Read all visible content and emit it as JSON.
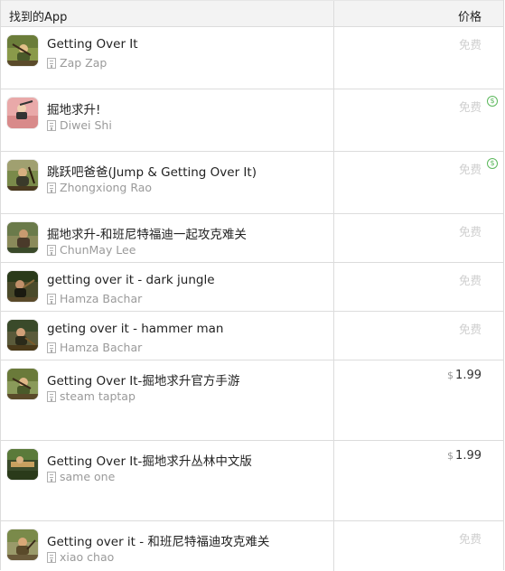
{
  "header": {
    "app_col": "找到的App",
    "price_col": "价格"
  },
  "rows": [
    {
      "name": "Getting Over It",
      "developer": "Zap Zap",
      "price": "免费",
      "paid": false,
      "iap": false
    },
    {
      "name": "掘地求升!",
      "developer": "Diwei Shi",
      "price": "免费",
      "paid": false,
      "iap": true
    },
    {
      "name": "跳跃吧爸爸(Jump & Getting Over It)",
      "developer": "Zhongxiong Rao",
      "price": "免费",
      "paid": false,
      "iap": true
    },
    {
      "name": "掘地求升-和班尼特福迪一起攻克难关",
      "developer": "ChunMay Lee",
      "price": "免费",
      "paid": false,
      "iap": false
    },
    {
      "name": "getting over it - dark jungle",
      "developer": "Hamza Bachar",
      "price": "免费",
      "paid": false,
      "iap": false
    },
    {
      "name": "geting over it - hammer man",
      "developer": "Hamza Bachar",
      "price": "免费",
      "paid": false,
      "iap": false
    },
    {
      "name": "Getting Over It-掘地求升官方手游",
      "developer": "steam taptap",
      "price": "1.99",
      "currency": "$",
      "paid": true,
      "iap": false
    },
    {
      "name": "Getting Over It-掘地求升丛林中文版",
      "developer": "same one",
      "price": "1.99",
      "currency": "$",
      "paid": true,
      "iap": false
    },
    {
      "name": "Getting over it - 和班尼特福迪攻克难关",
      "developer": "xiao chao",
      "price": "免费",
      "paid": false,
      "iap": false
    }
  ],
  "icons": {
    "developer": "developer-building-icon",
    "in_app_purchase": "in-app-purchase-dollar-icon",
    "iap_glyph": "$"
  },
  "colors": {
    "free_price": "#cfcfcf",
    "paid_price": "#333333",
    "iap_badge": "#5cb85c",
    "developer_text": "#9a9a9a"
  }
}
